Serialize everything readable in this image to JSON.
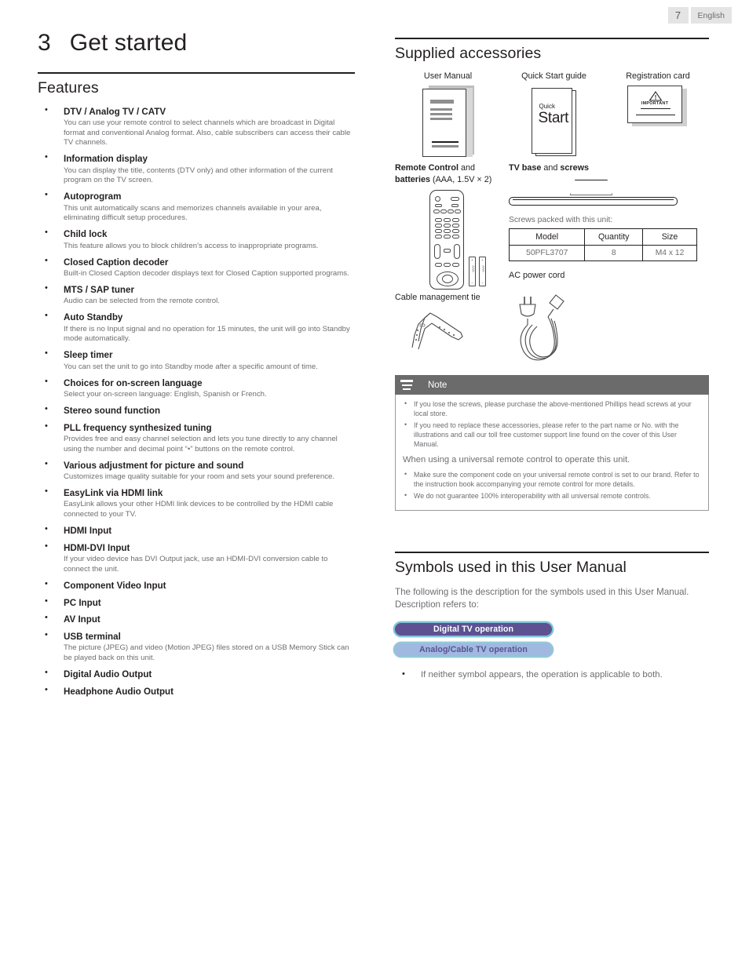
{
  "header": {
    "page_number": "7",
    "language": "English"
  },
  "chapter": {
    "number": "3",
    "title": "Get started"
  },
  "features_section": {
    "heading": "Features",
    "items": [
      {
        "title": "DTV / Analog TV / CATV",
        "desc": "You can use your remote control to select channels which are broadcast in Digital format and conventional Analog format. Also, cable subscribers can access their cable TV channels."
      },
      {
        "title": "Information display",
        "desc": "You can display the title, contents (DTV only) and other information of the current program on the TV screen."
      },
      {
        "title": "Autoprogram",
        "desc": "This unit automatically scans and memorizes channels available in your area, eliminating difficult setup procedures."
      },
      {
        "title": "Child lock",
        "desc": "This feature allows you to block children's access to inappropriate programs."
      },
      {
        "title": "Closed Caption decoder",
        "desc": "Built-in Closed Caption decoder displays text for Closed Caption supported programs."
      },
      {
        "title": "MTS / SAP tuner",
        "desc": "Audio can be selected from the remote control."
      },
      {
        "title": "Auto Standby",
        "desc": "If there is no Input signal and no operation for 15 minutes, the unit will go into Standby mode automatically."
      },
      {
        "title": "Sleep timer",
        "desc": "You can set the unit to go into Standby mode after a specific amount of time."
      },
      {
        "title": "Choices for on-screen language",
        "desc": "Select your on-screen language:  English, Spanish or French."
      },
      {
        "title": "Stereo sound function",
        "desc": ""
      },
      {
        "title": "PLL frequency synthesized tuning",
        "desc": "Provides free and easy channel selection and lets you tune directly to any channel using the number and decimal point “•” buttons on the remote control."
      },
      {
        "title": "Various adjustment for picture and sound",
        "desc": "Customizes image quality suitable for your room and sets your sound preference."
      },
      {
        "title": "EasyLink via HDMI link",
        "desc": "EasyLink allows your other HDMI link devices to be controlled by the HDMI cable connected to your TV."
      },
      {
        "title": "HDMI Input",
        "desc": ""
      },
      {
        "title": "HDMI-DVI Input",
        "desc": "If your video device has DVI Output jack, use an HDMI-DVI conversion cable to connect the unit."
      },
      {
        "title": "Component Video Input",
        "desc": ""
      },
      {
        "title": "PC Input",
        "desc": ""
      },
      {
        "title": "AV Input",
        "desc": ""
      },
      {
        "title": "USB terminal",
        "desc": "The picture (JPEG) and video (Motion JPEG) files stored on a USB Memory Stick can be played back on this unit."
      },
      {
        "title": "Digital Audio Output",
        "desc": ""
      },
      {
        "title": "Headphone Audio Output",
        "desc": ""
      }
    ]
  },
  "accessories_section": {
    "heading": "Supplied accessories",
    "user_manual_caption": "User Manual",
    "quick_start_caption": "Quick Start guide",
    "registration_caption": "Registration card",
    "quick_start_small": "Quick",
    "quick_start_big": "Start",
    "registration_word": "IMPORTANT",
    "remote_caption_bold": "Remote Control",
    "remote_caption_rest": " and",
    "remote_caption_line2_bold": "batteries",
    "remote_caption_line2_rest": " (AAA, 1.5V × 2)",
    "battery_label": "AAA",
    "battery_plus": "+",
    "battery_minus": "−",
    "tvbase_caption_bold1": "TV base",
    "tvbase_caption_mid": " and ",
    "tvbase_caption_bold2": "screws",
    "screws_lead": "Screws packed with this unit:",
    "screws_table": {
      "headers": [
        "Model",
        "Quantity",
        "Size"
      ],
      "rows": [
        [
          "50PFL3707",
          "8",
          "M4 x 12"
        ]
      ]
    },
    "ac_cord_caption": "AC power cord",
    "cable_tie_caption": "Cable management tie"
  },
  "note": {
    "title": "Note",
    "items": [
      "If you lose the screws, please purchase the above-mentioned Phillips head screws at your local store.",
      "If you need to replace these accessories, please refer to the part name or No. with the illustrations and call our toll free customer support line found on the cover of this User Manual."
    ],
    "subheading": "When using a universal remote control to operate this unit.",
    "items2": [
      "Make sure the component code on your universal remote control is set to our brand. Refer to the instruction book accompanying your remote control for more details.",
      "We do not guarantee 100% interoperability with all universal remote controls."
    ]
  },
  "symbols_section": {
    "heading": "Symbols used in this User Manual",
    "lead": "The following is the description for the symbols used in this User Manual. Description refers to:",
    "badge_digital": "Digital TV operation",
    "badge_analog": "Analog/Cable TV operation",
    "footnote": "If neither symbol appears, the operation is applicable to both.",
    "colors": {
      "digital_bg": "#5d5192",
      "digital_border": "#7fc4d6",
      "analog_bg": "#9fb9e0",
      "analog_text": "#5d5192",
      "analog_border": "#93c8d8"
    }
  }
}
